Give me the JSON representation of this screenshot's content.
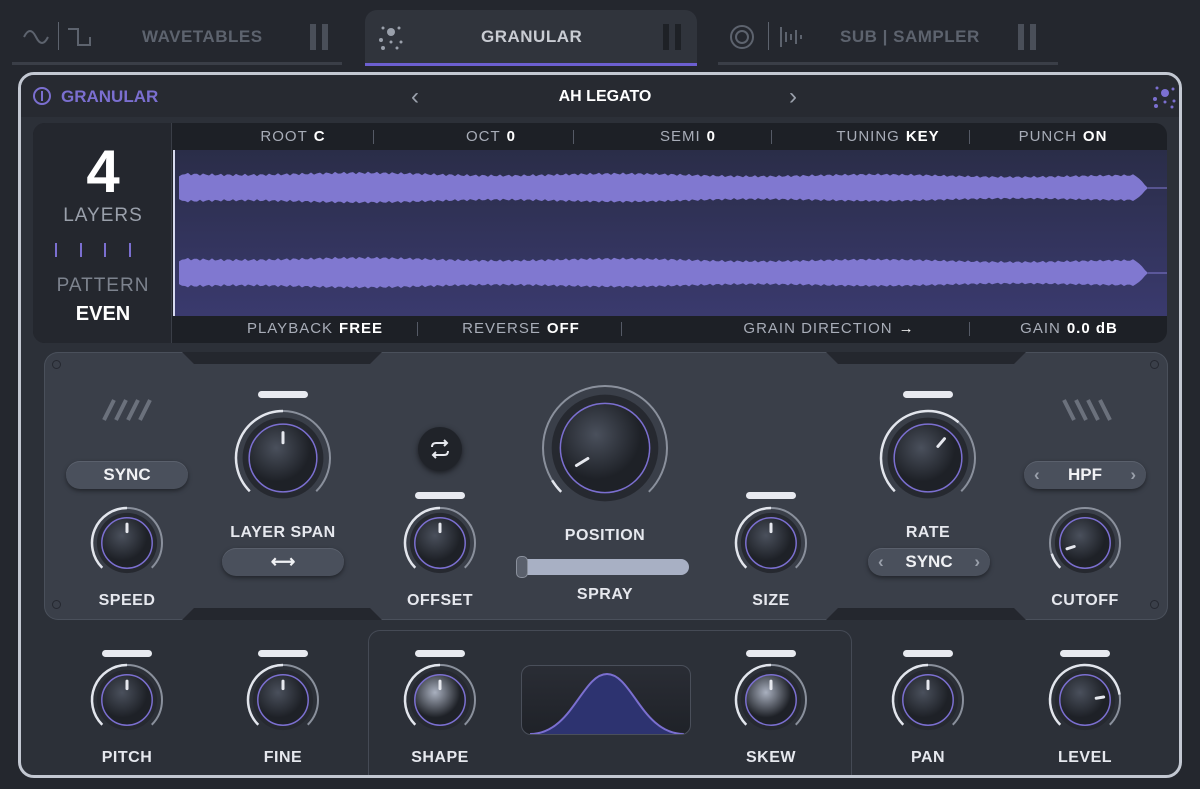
{
  "tabs": [
    {
      "label": "WAVETABLES",
      "icons": [
        "sine-wave-icon",
        "square-wave-icon"
      ],
      "active": false
    },
    {
      "label": "GRANULAR",
      "icons": [
        "granular-dots-icon"
      ],
      "active": true
    },
    {
      "label_a": "SUB",
      "label_b": "SAMPLER",
      "icons": [
        "sub-osc-icon",
        "sampler-icon"
      ],
      "active": false
    }
  ],
  "header": {
    "module_name": "GRANULAR",
    "preset_name": "AH LEGATO",
    "accent": "#7b6fd0"
  },
  "sample": {
    "layers_count": "4",
    "layers_label": "LAYERS",
    "pattern_label": "PATTERN",
    "pattern_value": "EVEN",
    "top_params": [
      {
        "label": "ROOT",
        "value": "C"
      },
      {
        "label": "OCT",
        "value": "0"
      },
      {
        "label": "SEMI",
        "value": "0"
      },
      {
        "label": "TUNING",
        "value": "KEY"
      },
      {
        "label": "PUNCH",
        "value": "ON"
      }
    ],
    "bottom_params": [
      {
        "label": "PLAYBACK",
        "value": "FREE"
      },
      {
        "label": "REVERSE",
        "value": "OFF"
      },
      {
        "label": "GRAIN DIRECTION",
        "value": "→"
      },
      {
        "label": "GAIN",
        "value": "0.0 dB"
      }
    ],
    "waveform_color": "#8078d0"
  },
  "controls": {
    "speed_mode": "SYNC",
    "layer_span_mode": "⟷",
    "rate_mode": "SYNC",
    "filter_type": "HPF",
    "knobs": {
      "speed": {
        "label": "SPEED",
        "value": 0.5
      },
      "layer_span": {
        "label": "LAYER SPAN",
        "value": 0.5
      },
      "offset": {
        "label": "OFFSET",
        "value": 0.5
      },
      "position": {
        "label": "POSITION",
        "value": 0.05
      },
      "spray": {
        "label": "SPRAY",
        "value": 1.0
      },
      "size": {
        "label": "SIZE",
        "value": 0.5
      },
      "rate": {
        "label": "RATE",
        "value": 0.65
      },
      "cutoff": {
        "label": "CUTOFF",
        "value": 0.1
      },
      "pitch": {
        "label": "PITCH",
        "value": 0.5
      },
      "fine": {
        "label": "FINE",
        "value": 0.5
      },
      "shape": {
        "label": "SHAPE",
        "value": 0.5
      },
      "skew": {
        "label": "SKEW",
        "value": 0.5
      },
      "pan": {
        "label": "PAN",
        "value": 0.5
      },
      "level": {
        "label": "LEVEL",
        "value": 0.8
      }
    }
  }
}
